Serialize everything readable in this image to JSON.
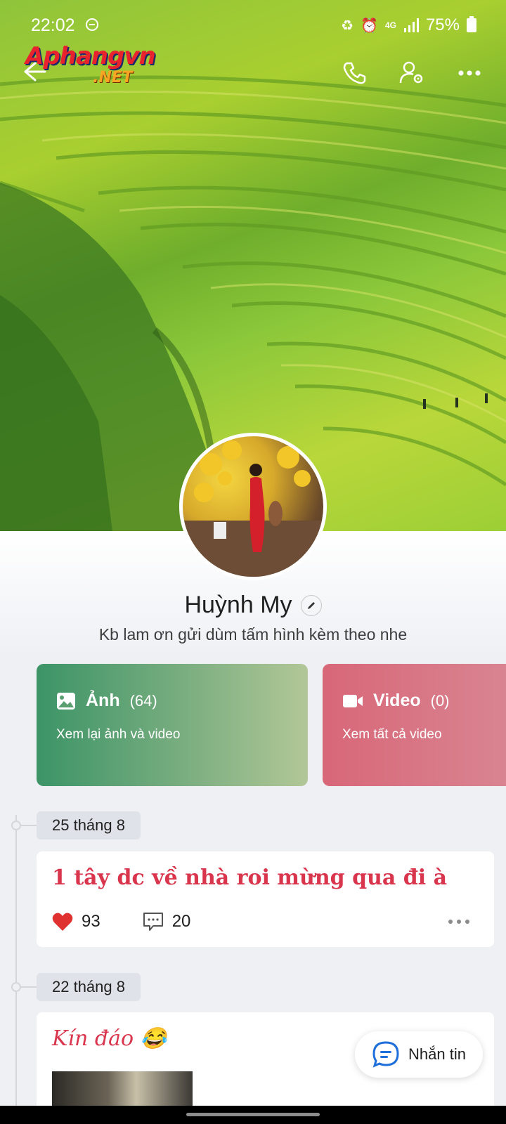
{
  "status_bar": {
    "time": "22:02",
    "network": "4G",
    "battery": "75%"
  },
  "logo": {
    "line1": "Aphangvn",
    "line2": ".NET"
  },
  "profile": {
    "name": "Huỳnh My",
    "status": "Kb lam ơn gửi dùm tấm hình kèm theo nhe"
  },
  "media": {
    "photos": {
      "title": "Ảnh",
      "count": "(64)",
      "subtitle": "Xem lại ảnh và video"
    },
    "videos": {
      "title": "Video",
      "count": "(0)",
      "subtitle": "Xem tất cả video"
    }
  },
  "timeline": [
    {
      "date": "25 tháng 8",
      "text": "1 tây dc về nhà roi mừng qua đi à",
      "likes": "93",
      "comments": "20"
    },
    {
      "date": "22 tháng 8",
      "text": "Kín đáo 😂"
    }
  ],
  "message_button": {
    "label": "Nhắn tin"
  },
  "colors": {
    "photo_card": "#3c9467",
    "video_card": "#d86778",
    "post_text": "#d9364e",
    "like": "#e03131"
  },
  "icons": [
    "back-arrow-icon",
    "phone-icon",
    "user-settings-icon",
    "more-icon",
    "image-icon",
    "video-camera-icon",
    "heart-icon",
    "comment-icon",
    "chat-bubble-icon",
    "pencil-icon"
  ]
}
